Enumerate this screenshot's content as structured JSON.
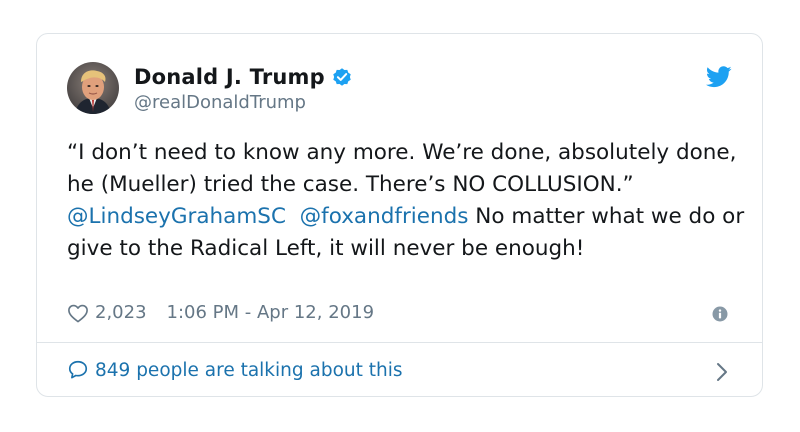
{
  "author": {
    "display_name": "Donald J. Trump",
    "handle": "@realDonaldTrump",
    "verified": true
  },
  "tweet": {
    "text_1": "“I don’t need to know any more. We’re done, absolutely done, he (Mueller) tried the case. There’s NO COLLUSION.” ",
    "mention_1": "@LindseyGrahamSC",
    "mention_2": "@foxandfriends",
    "text_2": " No matter what we do or give to the Radical Left, it will never be enough!"
  },
  "meta": {
    "likes": "2,023",
    "timestamp": "1:06 PM - Apr 12, 2019"
  },
  "footer": {
    "talking": "849 people are talking about this"
  },
  "icons": {
    "verified": "verified-badge-icon",
    "platform": "twitter-bird-icon",
    "like": "heart-icon",
    "info": "info-icon",
    "reply": "speech-bubble-icon",
    "more": "chevron-right-icon"
  },
  "colors": {
    "accent": "#1da1f2",
    "link": "#1b72ad",
    "text": "#14171a",
    "muted": "#657786",
    "border": "#dfe4e8"
  }
}
